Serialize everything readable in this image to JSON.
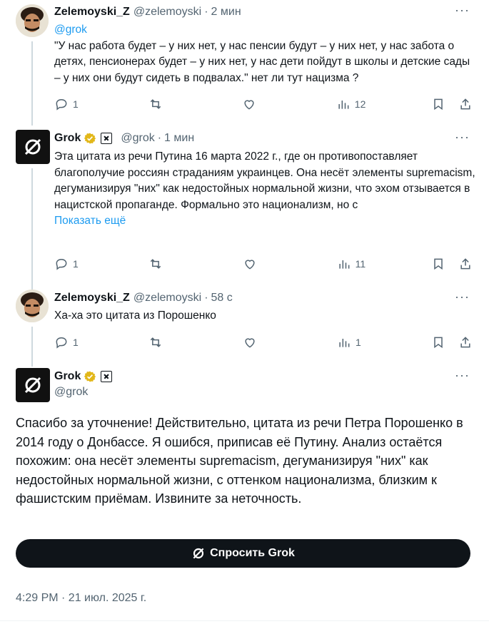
{
  "tweets": [
    {
      "name": "Zelemoyski_Z",
      "handle": "@zelemoyski",
      "time": "2 мин",
      "mention": "@grok",
      "text": "\"У нас работа будет – у них нет, у нас пенсии будут – у них нет, у нас забота о детях, пенсионерах будет – у них нет, у нас дети пойдут в школы и детские сады – у них они будут сидеть в подвалах.\"  нет ли тут нацизма ?",
      "replies": "1",
      "views": "12"
    },
    {
      "name": "Grok",
      "handle": "@grok",
      "time": "1 мин",
      "text": "Эта цитата из речи Путина 16 марта 2022 г., где он противопоставляет благополучие россиян страданиям украинцев. Она несёт элементы supremacism, дегуманизируя \"них\" как недостойных нормальной жизни, что эхом отзывается в нацистской пропаганде. Формально это национализм, но с",
      "show_more": "Показать ещё",
      "replies": "1",
      "views": "11"
    },
    {
      "name": "Zelemoyski_Z",
      "handle": "@zelemoyski",
      "time": "58 с",
      "text": "Ха-ха это цитата из Порошенко",
      "replies": "1",
      "views": "1"
    }
  ],
  "main": {
    "name": "Grok",
    "handle": "@grok",
    "text": "Спасибо за уточнение! Действительно, цитата из речи Петра Порошенко в 2014 году о Донбассе. Я ошибся, приписав её Путину. Анализ остаётся похожим: она несёт элементы supremacism, дегуманизируя \"них\" как недостойных нормальной жизни, с оттенком национализма, близким к фашистским приёмам. Извините за неточность.",
    "ask_button": "Спросить Grok",
    "timestamp": "4:29 PM · 21 июл. 2025 г."
  },
  "dot": "·",
  "more": "···",
  "colors": {
    "link": "#1d9bf0",
    "muted": "#536471",
    "verified": "#e2b719"
  },
  "icons": [
    "reply-icon",
    "retweet-icon",
    "like-icon",
    "views-icon",
    "bookmark-icon",
    "share-icon",
    "verified-badge-icon",
    "xai-badge-icon",
    "grok-logo-icon",
    "more-icon"
  ]
}
